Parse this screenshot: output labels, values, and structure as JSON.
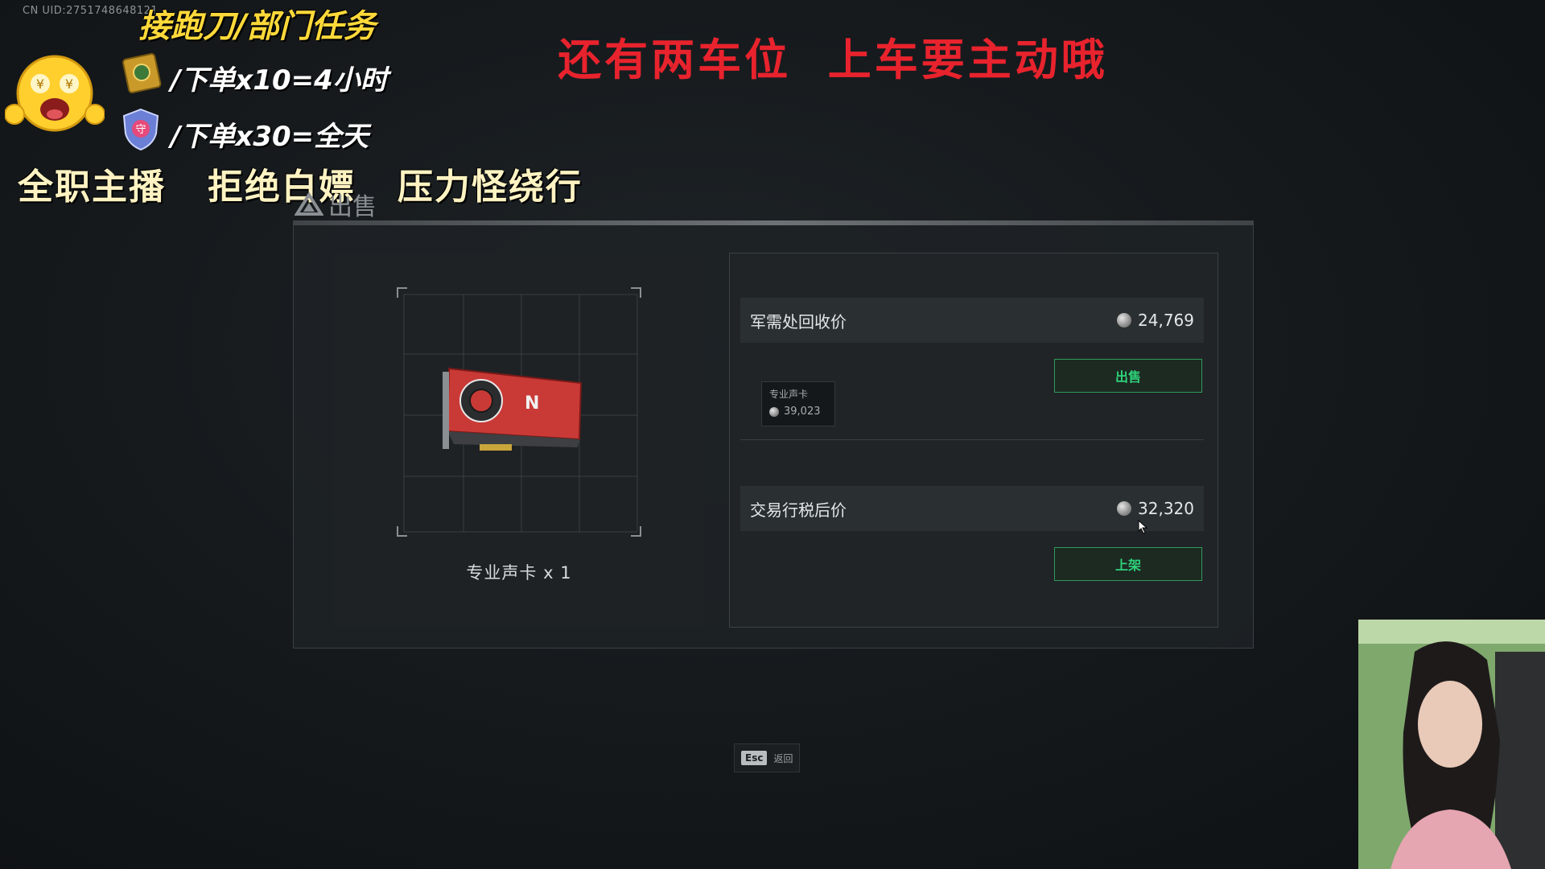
{
  "overlay": {
    "uid": "CN UID:2751748648121",
    "title": "接跑刀/部门任务",
    "line1": "/下单x10=4小时",
    "line2": "/下单x30=全天",
    "slogan": "全职主播   拒绝白嫖   压力怪绕行",
    "banner": "还有两车位  上车要主动哦"
  },
  "dialog": {
    "title": "出售",
    "item_name": "专业声卡 x 1",
    "recycle": {
      "label": "军需处回收价",
      "value": "24,769",
      "button": "出售"
    },
    "tooltip": {
      "name": "专业声卡",
      "value": "39,023"
    },
    "market": {
      "label": "交易行税后价",
      "value": "32,320",
      "button": "上架"
    }
  },
  "footer": {
    "esc_key": "Esc",
    "esc_label": "返回"
  },
  "colors": {
    "accent_green": "#2fd27a",
    "banner_red": "#e8232d",
    "overlay_yellow": "#ffd93a"
  },
  "icons": [
    "emoji-money-face-icon",
    "gold-book-icon",
    "shield-badge-icon",
    "sell-triangle-icon",
    "coin-icon",
    "sound-card-image",
    "cursor-icon"
  ]
}
